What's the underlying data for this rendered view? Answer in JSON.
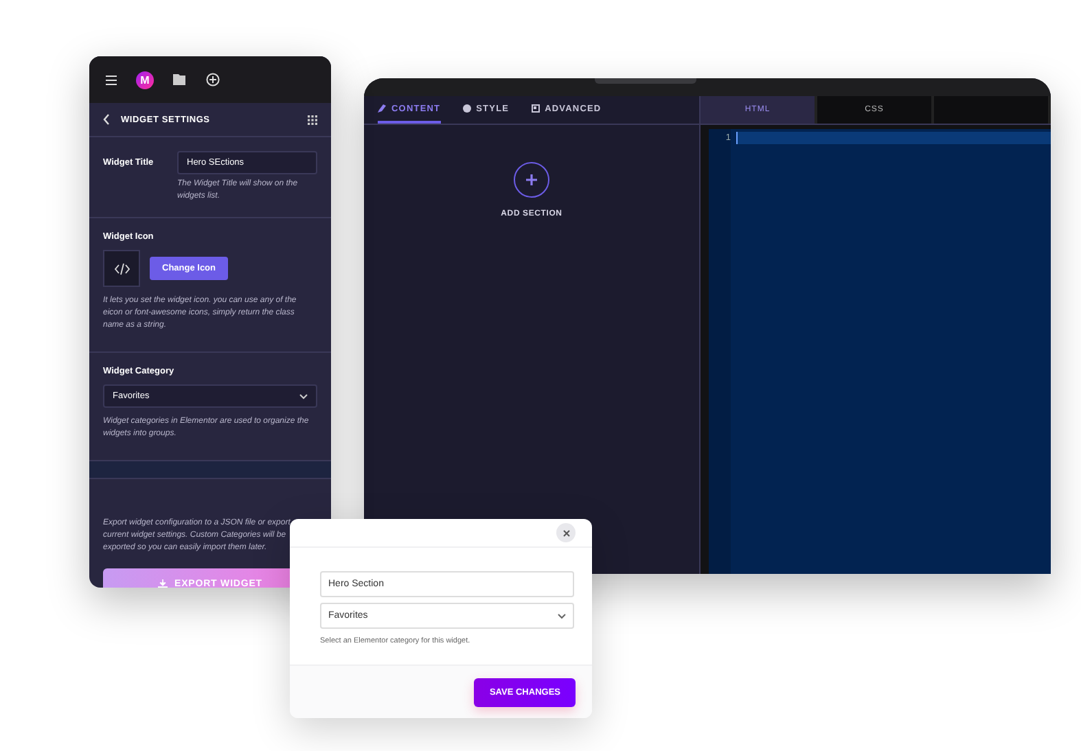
{
  "settings_panel": {
    "logo_letter": "M",
    "title": "WIDGET SETTINGS",
    "widget_title": {
      "label": "Widget Title",
      "value": "Hero SEctions",
      "hint": "The Widget Title will show on the widgets list."
    },
    "widget_icon": {
      "label": "Widget Icon",
      "button": "Change Icon",
      "hint": "It lets you set the widget icon. you can use any of the eicon or font-awesome icons, simply return the class name as a string."
    },
    "widget_category": {
      "label": "Widget Category",
      "value": "Favorites",
      "hint": "Widget categories in Elementor are used to organize the widgets into groups."
    },
    "export_text": "Export widget configuration to a JSON file or export current widget settings. Custom Categories will be exported so you can easily import them later.",
    "export_button": "EXPORT WIDGET"
  },
  "editor": {
    "tabs": [
      {
        "label": "CONTENT",
        "selected": true
      },
      {
        "label": "STYLE",
        "selected": false
      },
      {
        "label": "ADVANCED",
        "selected": false
      }
    ],
    "add_section": "ADD SECTION",
    "code_tabs": [
      {
        "label": "HTML",
        "selected": true
      },
      {
        "label": "CSS",
        "selected": false
      },
      {
        "selected": false
      }
    ],
    "line_number": "1"
  },
  "modal": {
    "title_value": "Hero Section",
    "category_value": "Favorites",
    "hint": "Select an Elementor category for this widget.",
    "save_button": "SAVE CHANGES"
  }
}
